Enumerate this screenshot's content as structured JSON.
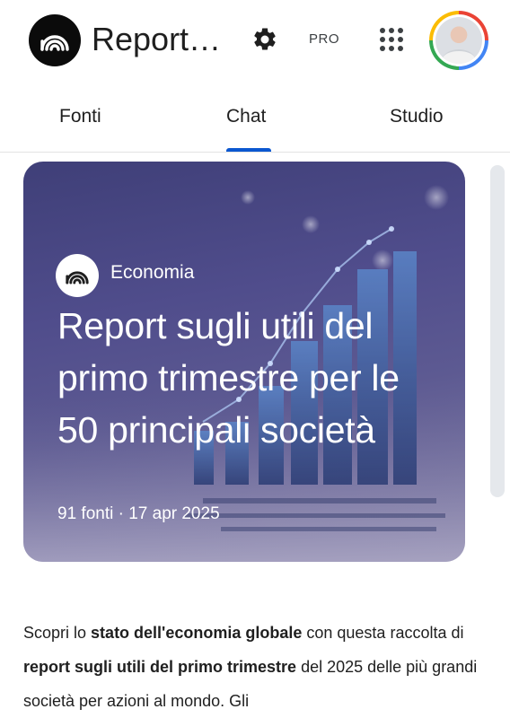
{
  "app": {
    "title": "Report…",
    "logo_icon": "notebook-logo-icon",
    "pro_label": "PRO",
    "settings_icon": "gear-icon",
    "apps_icon": "apps-grid-icon",
    "avatar_icon": "user-avatar"
  },
  "tabs": [
    {
      "label": "Fonti",
      "active": false
    },
    {
      "label": "Chat",
      "active": true
    },
    {
      "label": "Studio",
      "active": false
    }
  ],
  "accent_color": "#0b57d0",
  "card": {
    "topic": "Economia",
    "title": "Report sugli utili del primo trimestre per le 50 principali società",
    "meta": "91 fonti · 17 apr 2025"
  },
  "description": {
    "p1": "Scopri lo ",
    "b1": "stato dell'economia globale",
    "p2": " con questa raccolta di ",
    "b2": "report sugli utili del primo trimestre",
    "p3": " del 2025 delle più grandi società per azioni al mondo. Gli"
  }
}
